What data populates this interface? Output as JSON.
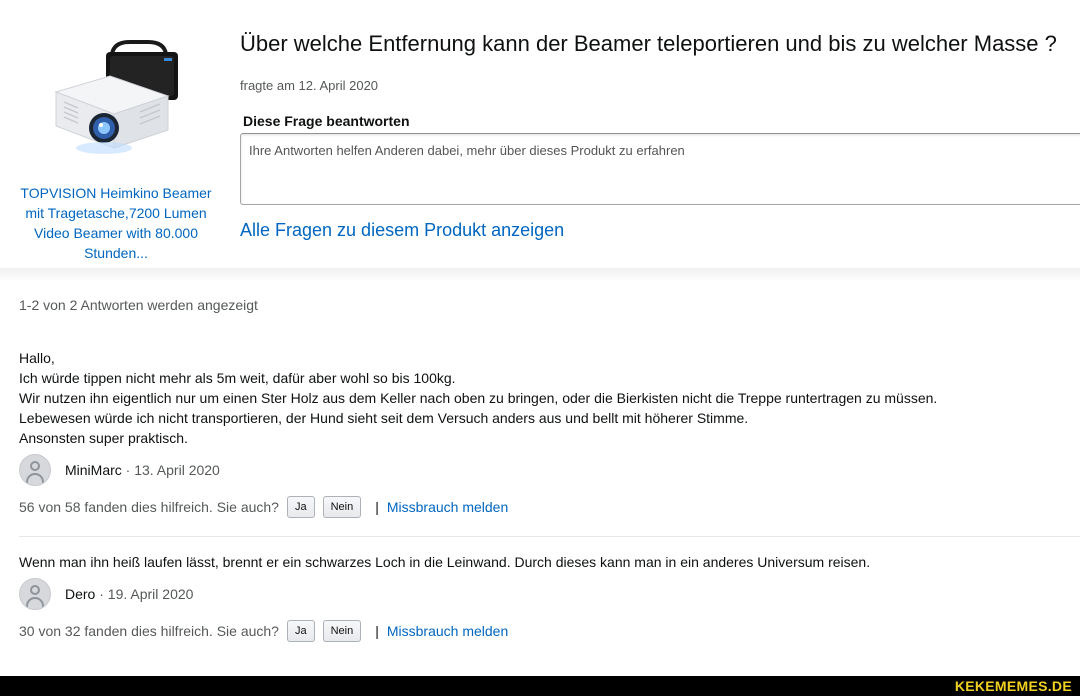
{
  "product": {
    "title": "TOPVISION Heimkino Beamer mit Tragetasche,7200 Lumen Video Beamer with 80.000 Stunden..."
  },
  "question": {
    "title": "Über welche Entfernung kann der Beamer teleportieren und bis zu welcher Masse ?",
    "asked": "fragte am 12. April 2020"
  },
  "answer_form": {
    "heading": "Diese Frage beantworten",
    "placeholder": "Ihre Antworten helfen Anderen dabei, mehr über dieses Produkt zu erfahren"
  },
  "all_questions_link": "Alle Fragen zu diesem Produkt anzeigen",
  "answers_count": "1-2 von 2 Antworten werden angezeigt",
  "answers": [
    {
      "lines": [
        "Hallo,",
        "Ich würde tippen nicht mehr als 5m weit, dafür aber wohl so bis 100kg.",
        "Wir nutzen ihn eigentlich nur um einen Ster Holz aus dem Keller nach oben zu bringen, oder die Bierkisten nicht die Treppe runtertragen zu müssen.",
        "Lebewesen würde ich nicht transportieren, der Hund sieht seit dem Versuch anders aus und bellt mit höherer Stimme.",
        "Ansonsten super praktisch."
      ],
      "author": "MiniMarc",
      "date": " · 13. April 2020",
      "helpful": "56 von 58 fanden dies hilfreich. Sie auch?",
      "yes": "Ja",
      "no": "Nein",
      "separator": "|",
      "report": "Missbrauch melden"
    },
    {
      "lines": [
        "Wenn man ihn heiß laufen lässt, brennt er ein schwarzes Loch in die Leinwand. Durch dieses kann man in ein anderes Universum reisen."
      ],
      "author": "Dero",
      "date": " · 19. April 2020",
      "helpful": "30 von 32 fanden dies hilfreich. Sie auch?",
      "yes": "Ja",
      "no": "Nein",
      "separator": "|",
      "report": "Missbrauch melden"
    }
  ],
  "watermark": "KEKEMEMES.DE",
  "icons": {
    "product_image": "projector-with-bag-image",
    "avatar": "user-avatar-icon"
  },
  "colors": {
    "link": "#0066c0",
    "text": "#0f1111",
    "muted": "#565959",
    "watermark": "#f0d020"
  }
}
